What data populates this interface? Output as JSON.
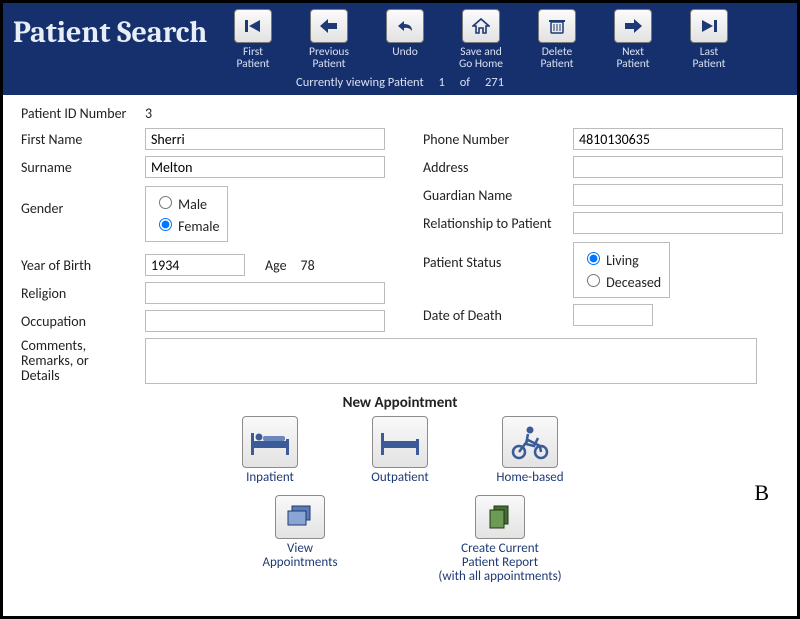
{
  "title": "Patient Search",
  "toolbar": [
    {
      "id": "first",
      "label": "First\nPatient"
    },
    {
      "id": "prev",
      "label": "Previous\nPatient"
    },
    {
      "id": "undo",
      "label": "Undo"
    },
    {
      "id": "savehome",
      "label": "Save and\nGo Home"
    },
    {
      "id": "delete",
      "label": "Delete\nPatient"
    },
    {
      "id": "next",
      "label": "Next\nPatient"
    },
    {
      "id": "last",
      "label": "Last\nPatient"
    }
  ],
  "viewing": {
    "prefix": "Currently viewing Patient",
    "index": "1",
    "of": "of",
    "total": "271"
  },
  "labels": {
    "patient_id": "Patient ID Number",
    "first_name": "First Name",
    "surname": "Surname",
    "gender": "Gender",
    "male": "Male",
    "female": "Female",
    "yob": "Year of Birth",
    "age": "Age",
    "religion": "Religion",
    "occupation": "Occupation",
    "comments": "Comments,\nRemarks, or\nDetails",
    "phone": "Phone Number",
    "address": "Address",
    "guardian": "Guardian Name",
    "relationship": "Relationship to Patient",
    "status": "Patient Status",
    "living": "Living",
    "deceased": "Deceased",
    "dod": "Date of Death",
    "new_appt": "New Appointment",
    "inpatient": "Inpatient",
    "outpatient": "Outpatient",
    "homebased": "Home-based",
    "view_appts": "View\nAppointments",
    "report": "Create Current\nPatient Report\n(with all appointments)"
  },
  "values": {
    "patient_id": "3",
    "first_name": "Sherri",
    "surname": "Melton",
    "gender": "Female",
    "yob": "1934",
    "age": "78",
    "religion": "",
    "occupation": "",
    "phone": "4810130635",
    "address": "",
    "guardian": "",
    "relationship": "",
    "status": "Living",
    "dod": "",
    "comments": ""
  },
  "corner": "B"
}
